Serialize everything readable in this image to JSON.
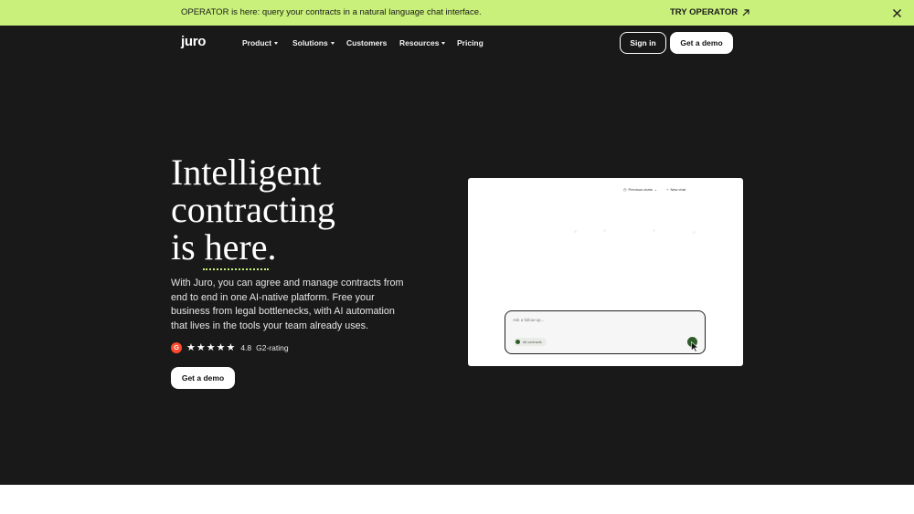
{
  "banner": {
    "text": "OPERATOR is here: query your contracts in a natural language chat interface.",
    "cta_label": "TRY OPERATOR"
  },
  "nav": {
    "logo": "juro",
    "items": [
      {
        "label": "Product",
        "has_caret": true
      },
      {
        "label": "Solutions",
        "has_caret": true
      },
      {
        "label": "Customers",
        "has_caret": false
      },
      {
        "label": "Resources",
        "has_caret": true
      },
      {
        "label": "Pricing",
        "has_caret": false
      }
    ],
    "signin_label": "Sign in",
    "demo_label": "Get a demo"
  },
  "hero": {
    "headline": [
      "Intelligent",
      "contracting",
      "is here."
    ],
    "subcopy": "With Juro, you can agree and manage contracts from end to end in one AI-native platform. Free your business from legal bottlenecks, with AI automation that lives in the tools your team already uses.",
    "rating": {
      "badge": "G",
      "stars": "★★★★★",
      "score": "4.8",
      "label": "G2-rating"
    },
    "cta_label": "Get a demo"
  },
  "mockup": {
    "previous_chats": "Previous chats",
    "new_chat": "New chat",
    "placeholder": "Ask a follow-up...",
    "chip_label": "All contracts"
  },
  "colors": {
    "banner_bg": "#c9f07a",
    "hero_bg": "#191919",
    "accent": "#c9f07a",
    "g2_red": "#ff492c",
    "operator_green": "#2f5d2a"
  }
}
